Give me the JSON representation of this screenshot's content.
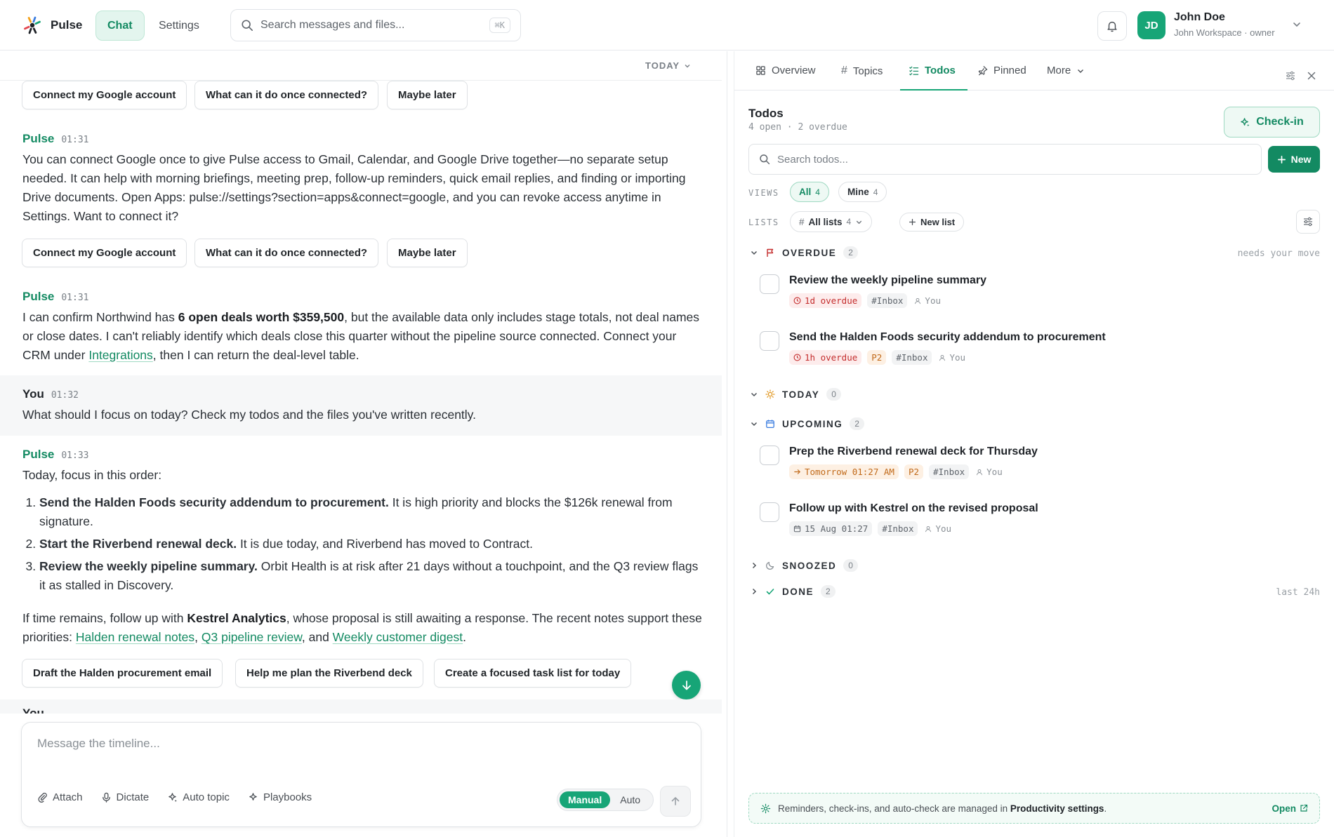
{
  "app": {
    "name": "Pulse"
  },
  "nav": {
    "chat": "Chat",
    "settings": "Settings"
  },
  "search": {
    "placeholder": "Search messages and files...",
    "shortcut": "⌘K"
  },
  "user": {
    "initials": "JD",
    "name": "John Doe",
    "workspace": "John Workspace · owner"
  },
  "chat": {
    "day_label": "TODAY",
    "chips_1": [
      "Connect my Google account",
      "What can it do once connected?",
      "Maybe later"
    ],
    "msg1": {
      "author": "Pulse",
      "time": "01:31",
      "text": "You can connect Google once to give Pulse access to Gmail, Calendar, and Google Drive together—no separate setup needed. It can help with morning briefings, meeting prep, follow-up reminders, quick email replies, and finding or importing Drive documents. Open Apps: pulse://settings?section=apps&connect=google, and you can revoke access anytime in Settings. Want to connect it?"
    },
    "chips_2": [
      "Connect my Google account",
      "What can it do once connected?",
      "Maybe later"
    ],
    "msg2": {
      "author": "Pulse",
      "time": "01:31",
      "part1": "I can confirm Northwind has ",
      "bold": "6 open deals worth $359,500",
      "part2": ", but the available data only includes stage totals, not deal names or close dates. I can't reliably identify which deals close this quarter without the pipeline source connected. Connect your CRM under ",
      "link": "Integrations",
      "part3": ", then I can return the deal-level table."
    },
    "msg3": {
      "author": "You",
      "time": "01:32",
      "text": "What should I focus on today? Check my todos and the files you've written recently."
    },
    "msg4": {
      "author": "Pulse",
      "time": "01:33",
      "intro": "Today, focus in this order:",
      "items": [
        {
          "bold": "Send the Halden Foods security addendum to procurement.",
          "rest": " It is high priority and blocks the $126k renewal from signature."
        },
        {
          "bold": "Start the Riverbend renewal deck.",
          "rest": " It is due today, and Riverbend has moved to Contract."
        },
        {
          "bold": "Review the weekly pipeline summary.",
          "rest": " Orbit Health is at risk after 21 days without a touchpoint, and the Q3 review flags it as stalled in Discovery."
        }
      ],
      "outro1": "If time remains, follow up with ",
      "outro_bold": "Kestrel Analytics",
      "outro2": ", whose proposal is still awaiting a response. The recent notes support these priorities: ",
      "links": [
        "Halden renewal notes",
        "Q3 pipeline review",
        "Weekly customer digest"
      ],
      "sep1": ", ",
      "sep2": ", and ",
      "end": "."
    },
    "chips_3": [
      "Draft the Halden procurement email",
      "Help me plan the Riverbend deck",
      "Create a focused task list for today"
    ],
    "peek_author": "You"
  },
  "composer": {
    "placeholder": "Message the timeline...",
    "tools": [
      "Attach",
      "Dictate",
      "Auto topic",
      "Playbooks"
    ],
    "mode_manual": "Manual",
    "mode_auto": "Auto"
  },
  "panel": {
    "tabs": [
      "Overview",
      "Topics",
      "Todos",
      "Pinned",
      "More"
    ],
    "title": "Todos",
    "subtitle": "4 open · 2 overdue",
    "checkin": "Check-in",
    "search_placeholder": "Search todos...",
    "new_label": "New",
    "views_label": "VIEWS",
    "views": [
      {
        "label": "All",
        "count": "4"
      },
      {
        "label": "Mine",
        "count": "4"
      }
    ],
    "lists_label": "LISTS",
    "all_lists": {
      "label": "All lists",
      "count": "4"
    },
    "new_list": "New list",
    "sections": {
      "overdue": {
        "label": "OVERDUE",
        "count": "2",
        "note": "needs your move"
      },
      "today": {
        "label": "TODAY",
        "count": "0"
      },
      "upcoming": {
        "label": "UPCOMING",
        "count": "2"
      },
      "snoozed": {
        "label": "SNOOZED",
        "count": "0"
      },
      "done": {
        "label": "DONE",
        "count": "2",
        "note": "last 24h"
      }
    },
    "todos": [
      {
        "title": "Review the weekly pipeline summary",
        "due": "1d overdue",
        "priority": "",
        "list": "#Inbox",
        "owner": "You"
      },
      {
        "title": "Send the Halden Foods security addendum to procurement",
        "due": "1h overdue",
        "priority": "P2",
        "list": "#Inbox",
        "owner": "You"
      },
      {
        "title": "Prep the Riverbend renewal deck for Thursday",
        "due": "Tomorrow 01:27 AM",
        "priority": "P2",
        "list": "#Inbox",
        "owner": "You"
      },
      {
        "title": "Follow up with Kestrel on the revised proposal",
        "due": "15 Aug 01:27",
        "priority": "",
        "list": "#Inbox",
        "owner": "You"
      }
    ],
    "footer": {
      "text": "Reminders, check-ins, and auto-check are managed in ",
      "bold": "Productivity settings",
      "end": ".",
      "open": "Open"
    }
  },
  "colors": {
    "accent": "#17a577",
    "accent_dark": "#138a62",
    "overdue": "#c42d2d",
    "upcoming": "#c16a1a"
  }
}
